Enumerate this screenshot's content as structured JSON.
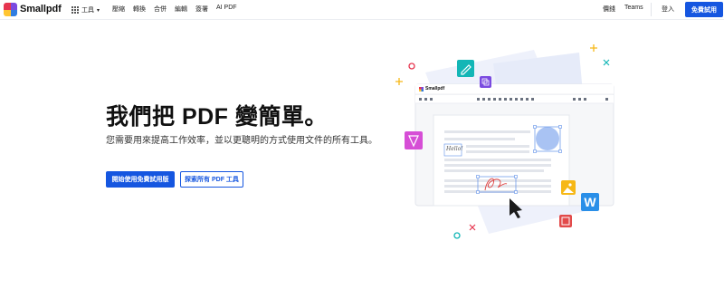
{
  "nav": {
    "brand": "Smallpdf",
    "tools_label": "工具",
    "links": [
      "壓縮",
      "轉換",
      "合併",
      "編輯",
      "簽署",
      "AI PDF"
    ],
    "pricing_label": "價錢",
    "teams_label": "Teams",
    "login_label": "登入",
    "cta_label": "免費試用"
  },
  "hero": {
    "title": "我們把 PDF 變簡單。",
    "subtitle": "您需要用來提高工作效率，並以更聰明的方式使用文件的所有工具。",
    "primary_button": "開始使用免費試用版",
    "secondary_button": "探索所有 PDF 工具"
  },
  "illustration": {
    "app_brand": "Smallpdf",
    "hello_text": "Hello!"
  },
  "colors": {
    "primary": "#1556e0",
    "logo_red": "#e6354f",
    "logo_purple": "#7a4ae0",
    "logo_yellow": "#ffc531",
    "logo_blue": "#2f7de1",
    "teal_icon": "#13b6b6",
    "pink_icon": "#d64ed6",
    "word_blue": "#2a8fe8",
    "red_icon": "#e24a4a",
    "image_yellow": "#f6b817"
  },
  "icons": [
    "grid-icon",
    "chevron-down-icon",
    "edit-icon",
    "pen-icon",
    "image-icon",
    "word-icon",
    "crop-icon",
    "sparkle-icon",
    "cursor-icon"
  ]
}
